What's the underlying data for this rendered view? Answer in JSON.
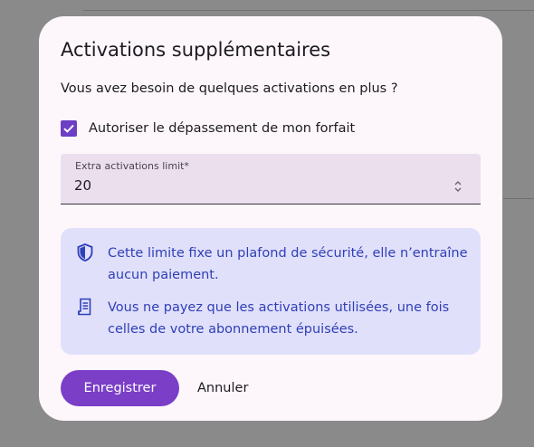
{
  "dialog": {
    "title": "Activations supplémentaires",
    "subtitle": "Vous avez besoin de quelques activations en plus ?"
  },
  "overage": {
    "label": "Autoriser le dépassement de mon forfait",
    "checked": true
  },
  "limit_field": {
    "label": "Extra activations limit*",
    "value": "20"
  },
  "info": {
    "items": [
      {
        "icon": "shield-icon",
        "text": "Cette limite fixe un plafond de sécurité, elle n’entraîne aucun paiement."
      },
      {
        "icon": "receipt-icon",
        "text": "Vous ne payez que les activations utilisées, une fois celles de votre abonnement épuisées."
      }
    ]
  },
  "actions": {
    "save": "Enregistrer",
    "cancel": "Annuler"
  },
  "colors": {
    "accent": "#7a3ec7",
    "info_text": "#2f3fb6",
    "info_bg": "#e1e0fb",
    "dialog_bg": "#fdf7fc",
    "field_bg": "#ebdfee"
  }
}
